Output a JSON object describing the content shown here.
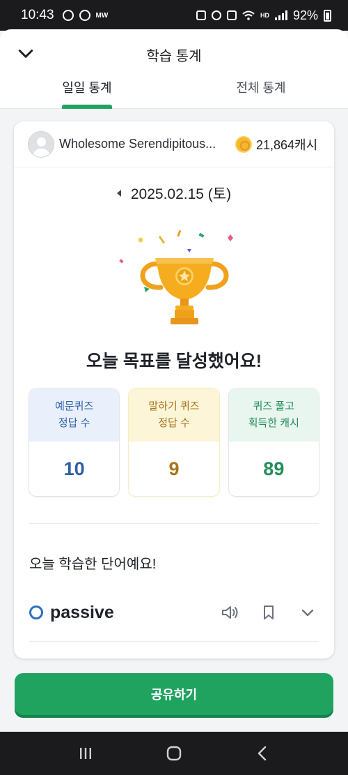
{
  "status_bar": {
    "time": "10:43",
    "left_icons": [
      "notification-icon",
      "speedometer-icon"
    ],
    "left_label": "MW",
    "right_icons": [
      "sleep-icon",
      "alarm-icon",
      "mute-icon",
      "wifi-icon",
      "volte-icon",
      "signal-icon",
      "battery-icon"
    ],
    "hd_label": "HD",
    "battery": "92%"
  },
  "header": {
    "title": "학습 통계",
    "back_icon": "chevron-down-icon",
    "tabs": [
      {
        "label": "일일 통계",
        "active": true
      },
      {
        "label": "전체 통계",
        "active": false
      }
    ],
    "accent_color": "#1fa35f"
  },
  "card": {
    "user": {
      "name": "Wholesome Serendipitous...",
      "cash": "21,864캐시",
      "coin_icon": "coin-icon"
    },
    "date": "2025.02.15 (토)",
    "trophy_icon": "trophy-icon",
    "goal_message": "오늘 목표를 달성했어요!",
    "stats": [
      {
        "label": "예문퀴즈\n정답 수",
        "value": "10",
        "color": "#2e5fa8"
      },
      {
        "label": "말하기 퀴즈\n정답 수",
        "value": "9",
        "color": "#a9741a"
      },
      {
        "label": "퀴즈 풀고\n획득한 캐시",
        "value": "89",
        "color": "#238d5a"
      }
    ],
    "words_title": "오늘 학습한 단어예요!",
    "words": [
      {
        "word": "passive",
        "icons": [
          "speaker-icon",
          "bookmark-icon",
          "chevron-down-icon"
        ]
      }
    ]
  },
  "share_button": {
    "label": "공유하기"
  },
  "nav_bar": {
    "icons": [
      "recent-apps-icon",
      "home-icon",
      "back-icon"
    ]
  }
}
